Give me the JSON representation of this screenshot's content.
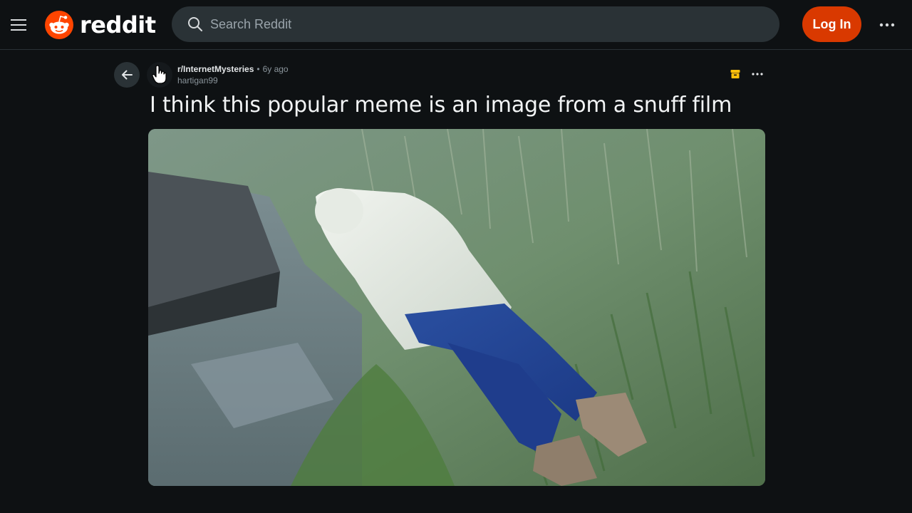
{
  "header": {
    "brand": "reddit",
    "search_placeholder": "Search Reddit",
    "login_label": "Log In",
    "icons": {
      "menu": "hamburger-menu-icon",
      "logo": "reddit-snoo-icon",
      "search": "search-icon",
      "more": "more-horizontal-icon"
    }
  },
  "post": {
    "subreddit": "r/InternetMysteries",
    "separator": "•",
    "age": "6y ago",
    "author": "hartigan99",
    "title": "I think this popular meme is an image from a snuff film",
    "icons": {
      "back": "arrow-left-icon",
      "avatar": "pointing-hand-cursor-icon",
      "archived": "archive-box-icon",
      "more": "more-horizontal-icon"
    }
  },
  "colors": {
    "background": "#0e1113",
    "accent_login": "#d93900",
    "brand_orange": "#ff4500",
    "archived_yellow": "#ffbf0b",
    "search_bg": "#2a3236"
  }
}
